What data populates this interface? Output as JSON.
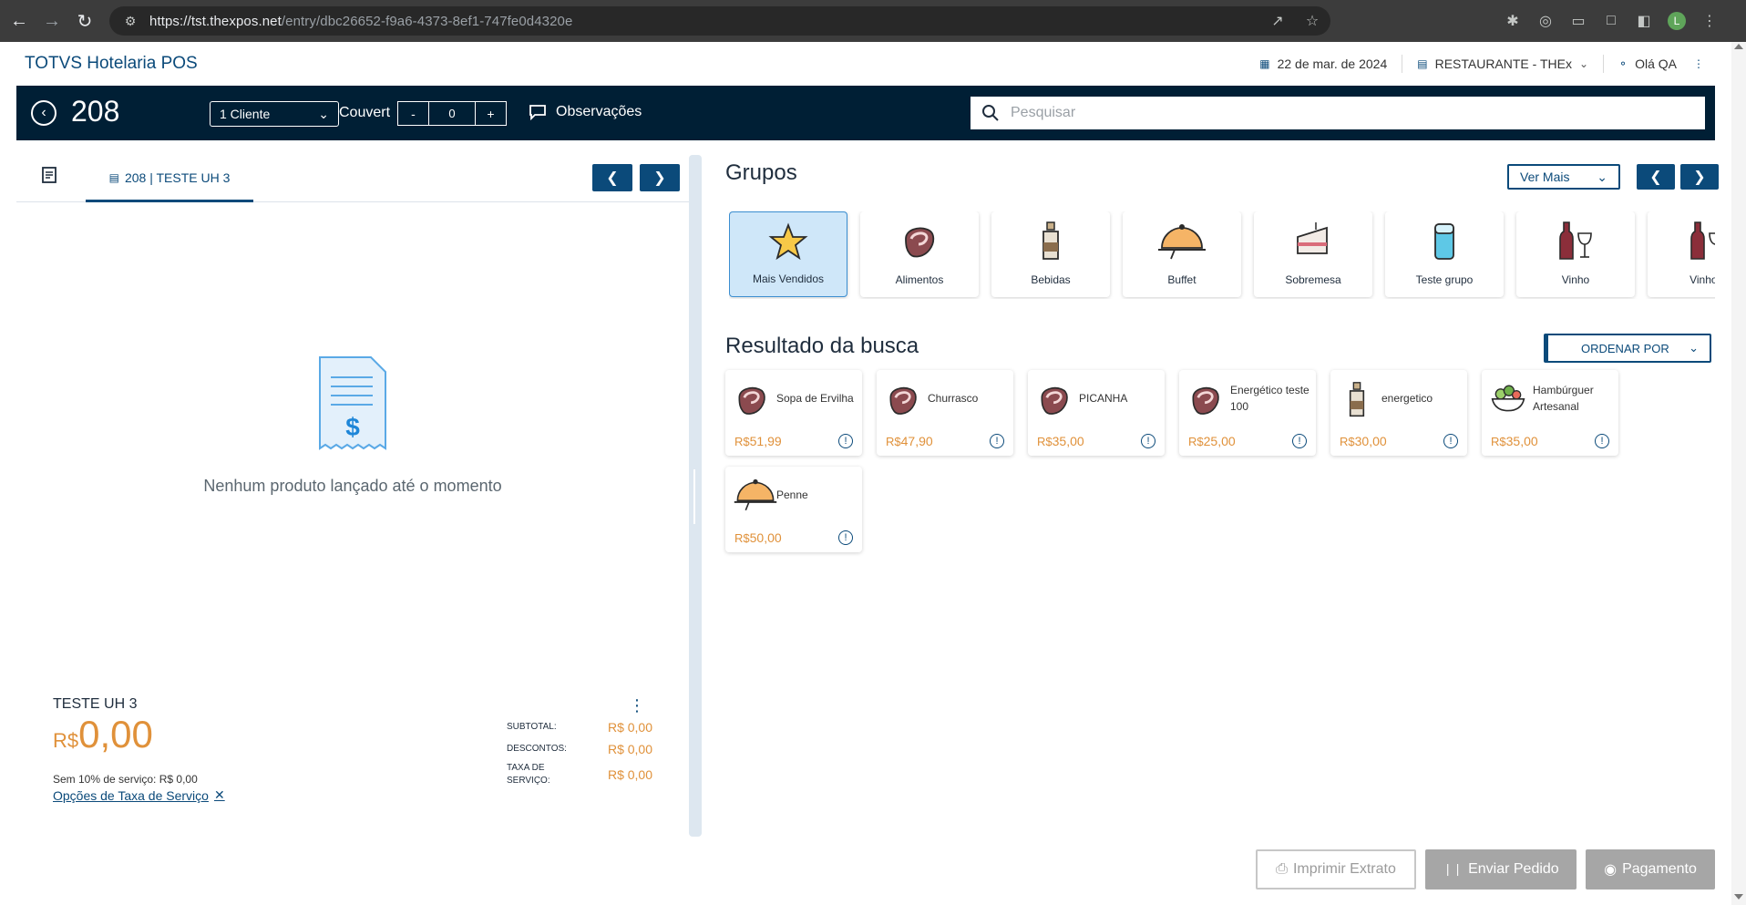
{
  "browser": {
    "url_host": "https://tst.thexpos.net",
    "url_path": "/entry/dbc26652-f9a6-4373-8ef1-747fe0d4320e",
    "profile_initial": "L"
  },
  "header": {
    "brand": "TOTVS Hotelaria POS",
    "date": "22 de mar. de 2024",
    "restaurant": "RESTAURANTE - THEx",
    "user": "Olá QA"
  },
  "toolbar": {
    "table_number": "208",
    "clients": "1 Cliente",
    "couvert_label": "Couvert",
    "couvert_minus": "-",
    "couvert_value": "0",
    "couvert_plus": "+",
    "observations": "Observações",
    "search_placeholder": "Pesquisar"
  },
  "order": {
    "tab_label": "208 | TESTE UH 3",
    "empty_message": "Nenhum produto lançado até o momento",
    "guest_name": "TESTE UH 3",
    "total_currency": "R$",
    "total_amount": "0,00",
    "service_note": "Sem 10% de serviço: R$ 0,00",
    "service_options_link": "Opções de Taxa de Serviço",
    "totals": [
      {
        "label": "SUBTOTAL:",
        "value": "R$ 0,00"
      },
      {
        "label": "DESCONTOS:",
        "value": "R$ 0,00"
      },
      {
        "label": "TAXA DE SERVIÇO:",
        "value": "R$ 0,00"
      }
    ]
  },
  "groups": {
    "title": "Grupos",
    "ver_mais": "Ver Mais",
    "items": [
      {
        "label": "Mais Vendidos",
        "icon": "star-icon",
        "active": true
      },
      {
        "label": "Alimentos",
        "icon": "steak-icon"
      },
      {
        "label": "Bebidas",
        "icon": "bottle-icon"
      },
      {
        "label": "Buffet",
        "icon": "cloche-icon"
      },
      {
        "label": "Sobremesa",
        "icon": "cake-icon"
      },
      {
        "label": "Teste grupo",
        "icon": "cup-icon"
      },
      {
        "label": "Vinho",
        "icon": "wine-icon"
      },
      {
        "label": "Vinho -",
        "icon": "wine-icon"
      }
    ]
  },
  "results": {
    "title": "Resultado da busca",
    "order_by": "ORDENAR POR",
    "currency": "R$",
    "products": [
      {
        "name": "Sopa de Ervilha",
        "price": "51,99",
        "icon": "steak-icon"
      },
      {
        "name": "Churrasco",
        "price": "47,90",
        "icon": "steak-icon"
      },
      {
        "name": "PICANHA",
        "price": "35,00",
        "icon": "steak-icon"
      },
      {
        "name": "Energético teste 100",
        "price": "25,00",
        "icon": "steak-icon"
      },
      {
        "name": "energetico",
        "price": "30,00",
        "icon": "bottle-icon"
      },
      {
        "name": "Hambúrguer Artesanal",
        "price": "35,00",
        "icon": "salad-icon"
      },
      {
        "name": "Penne",
        "price": "50,00",
        "icon": "cloche-icon"
      }
    ]
  },
  "actions": {
    "print": "Imprimir Extrato",
    "send": "Enviar Pedido",
    "pay": "Pagamento"
  },
  "colors": {
    "brand_dark": "#001f35",
    "brand_blue": "#0b4a7a",
    "price_orange": "#e0913a",
    "active_group_bg": "#cfe7f9"
  }
}
